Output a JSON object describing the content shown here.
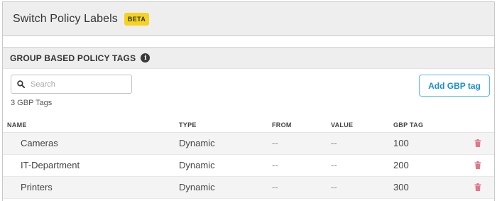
{
  "header": {
    "title": "Switch Policy Labels",
    "badge": "BETA"
  },
  "section": {
    "title": "GROUP BASED POLICY TAGS",
    "info_icon": "info-icon"
  },
  "search": {
    "placeholder": "Search",
    "value": ""
  },
  "count_label": "3 GBP Tags",
  "add_button_label": "Add GBP tag",
  "table": {
    "columns": [
      "NAME",
      "TYPE",
      "FROM",
      "VALUE",
      "GBP TAG"
    ],
    "rows": [
      {
        "name": "Cameras",
        "type": "Dynamic",
        "from": "--",
        "value": "--",
        "gbp_tag": "100"
      },
      {
        "name": "IT-Department",
        "type": "Dynamic",
        "from": "--",
        "value": "--",
        "gbp_tag": "200"
      },
      {
        "name": "Printers",
        "type": "Dynamic",
        "from": "--",
        "value": "--",
        "gbp_tag": "300"
      }
    ],
    "row_action_icon": "trash-icon"
  },
  "colors": {
    "badge": "#f5d31e",
    "accent": "#1a8fd1",
    "delete": "#e0788a"
  }
}
